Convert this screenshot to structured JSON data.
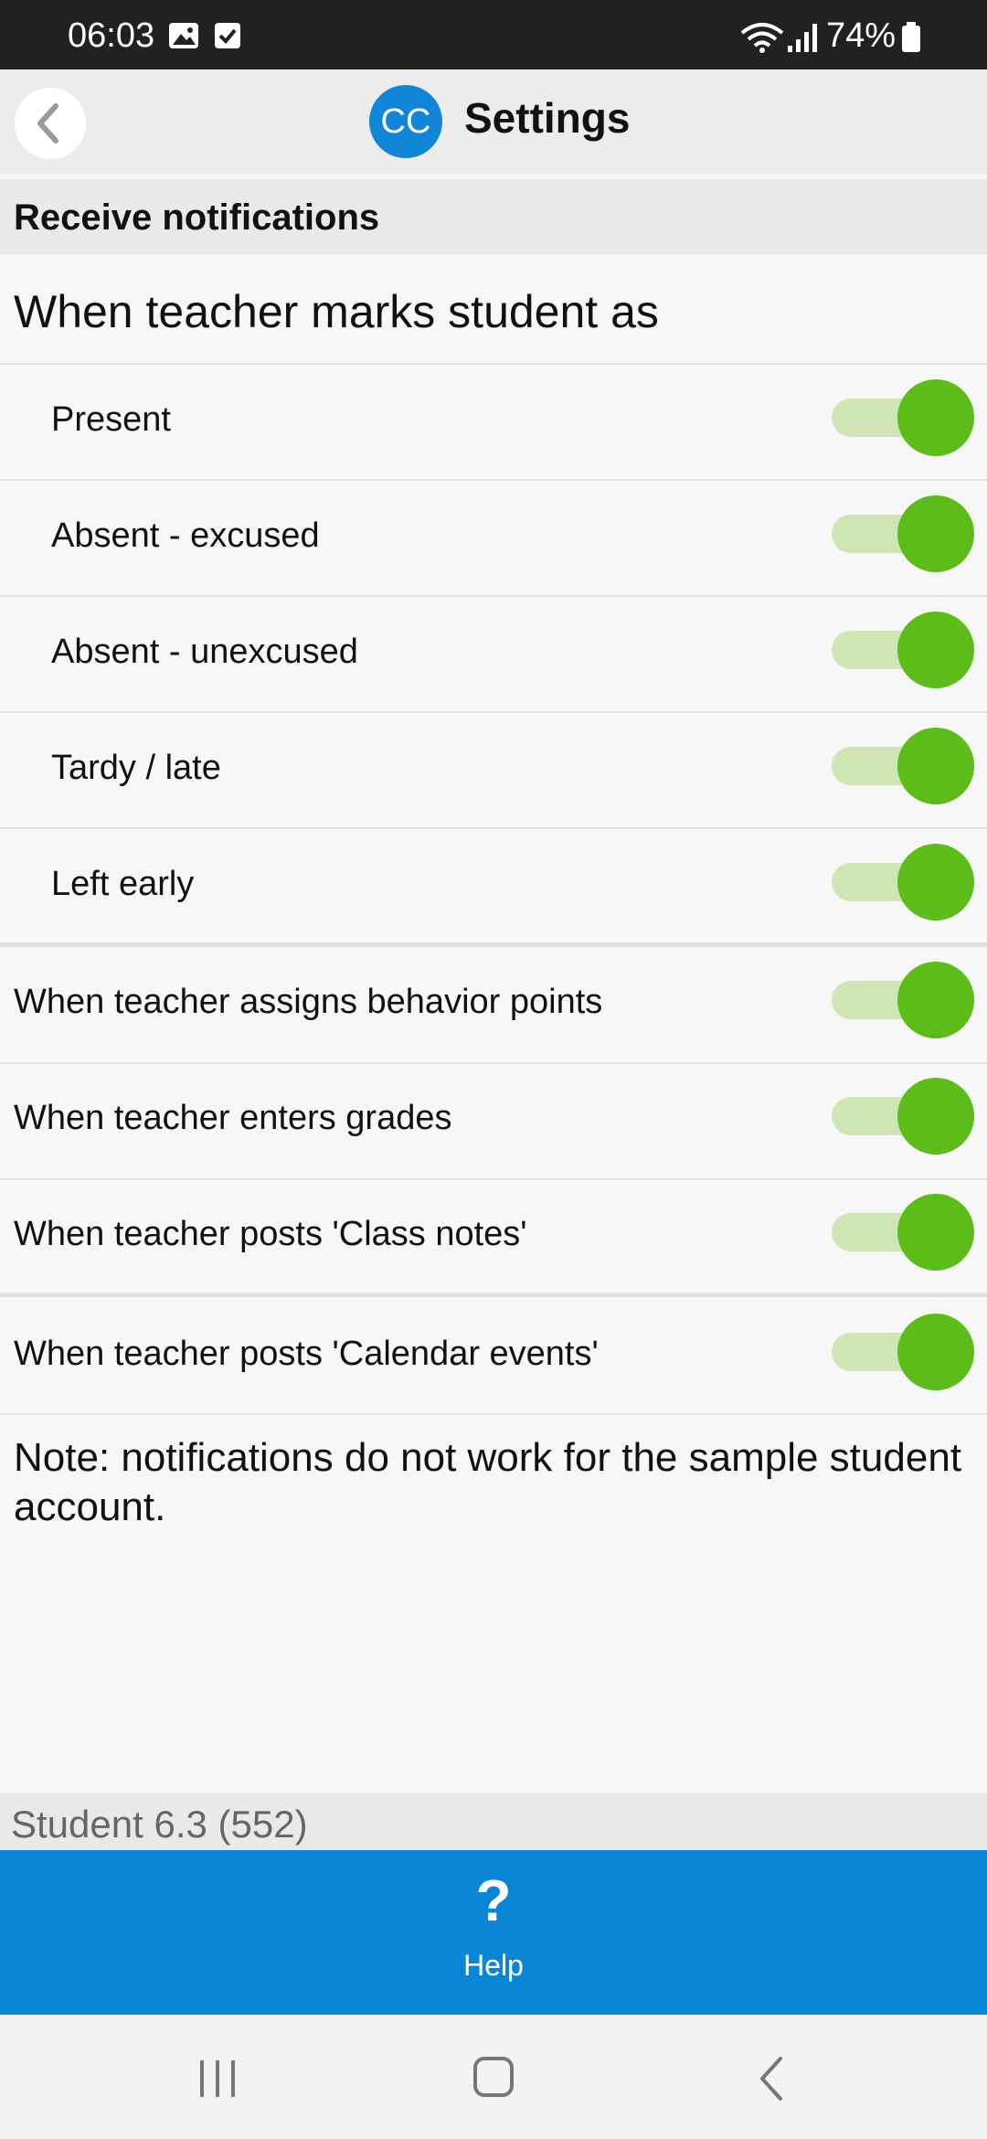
{
  "status_bar": {
    "time": "06:03",
    "battery": "74%"
  },
  "header": {
    "title": "Settings",
    "logo_text": "CC"
  },
  "section": {
    "heading": "Receive notifications"
  },
  "attendance": {
    "heading": "When teacher marks student as",
    "items": [
      {
        "label": "Present",
        "on": true
      },
      {
        "label": "Absent - excused",
        "on": true
      },
      {
        "label": "Absent - unexcused",
        "on": true
      },
      {
        "label": "Tardy / late",
        "on": true
      },
      {
        "label": "Left early",
        "on": true
      }
    ]
  },
  "other": {
    "items": [
      {
        "label": "When teacher assigns behavior points",
        "on": true
      },
      {
        "label": "When teacher enters grades",
        "on": true
      },
      {
        "label": "When teacher posts 'Class notes'",
        "on": true
      },
      {
        "label": "When teacher posts 'Calendar events'",
        "on": true
      }
    ]
  },
  "note": "Note: notifications do not work for the sample student account.",
  "footer": {
    "version": "Student 6.3 (552)",
    "help_label": "Help",
    "help_icon": "?"
  },
  "colors": {
    "accent": "#0a86d6",
    "toggle_on": "#5bbc1a",
    "toggle_track": "#cfe5b4"
  }
}
